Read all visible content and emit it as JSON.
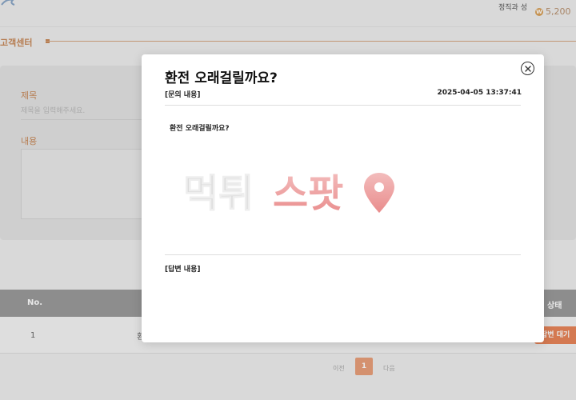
{
  "header": {
    "user_name": "정직과 성",
    "points": "5,200",
    "won_symbol": "W"
  },
  "page": {
    "section_title": "고객센터",
    "form": {
      "title_label": "제목",
      "title_placeholder": "제목을 입력해주세요.",
      "content_label": "내용"
    },
    "table": {
      "headers": {
        "no": "No.",
        "status": "상태"
      },
      "rows": [
        {
          "no": "1",
          "title": "환",
          "status": "답변 대기"
        }
      ]
    },
    "pagination": {
      "prev": "이전",
      "current": "1",
      "next": "다음"
    }
  },
  "modal": {
    "title": "환전 오래걸릴까요?",
    "inquiry_label": "[문의 내용]",
    "inquiry_date": "2025-04-05 13:37:41",
    "inquiry_body": "환전 오래걸릴까요?",
    "answer_label": "[답변 내용]",
    "watermark_text": "먹튀스팟"
  },
  "colors": {
    "accent": "#c98a5a",
    "badge": "#e9855a",
    "page_active": "#e9a07a",
    "table_header": "#9c9c9c"
  },
  "icons": {
    "close": "close-circle-icon",
    "won": "won-coin-icon",
    "logo": "logo-icon",
    "pin": "location-pin-icon"
  }
}
